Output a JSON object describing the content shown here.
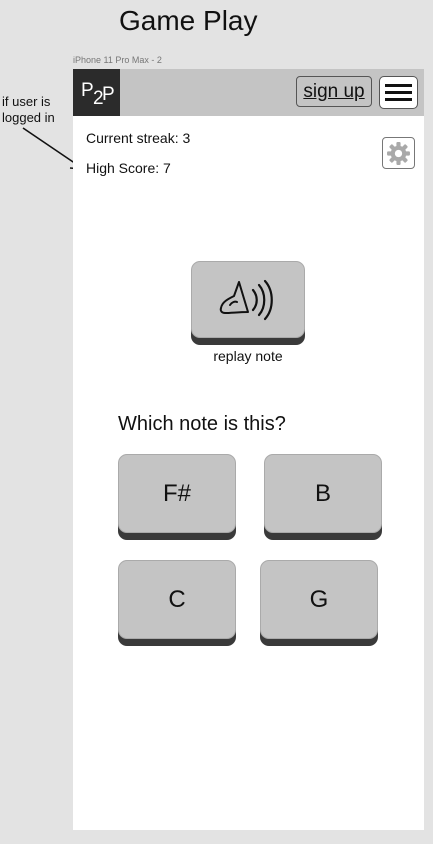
{
  "page": {
    "title": "Game Play",
    "frame_label": "iPhone 11 Pro Max - 2"
  },
  "annotation": {
    "line1": "if user is",
    "line2": "logged in"
  },
  "navbar": {
    "logo": {
      "p1": "P",
      "two": "2",
      "p2": "P"
    },
    "signup_label": "sign up",
    "menu_icon": "hamburger-menu-icon",
    "background": "#c4c4c4",
    "logo_background": "#2b2b2b"
  },
  "stats": {
    "current_streak": "Current streak: 3",
    "high_score": "High Score: 7"
  },
  "settings": {
    "icon": "gear-icon"
  },
  "replay": {
    "label": "replay note",
    "icon": "speaker-icon"
  },
  "question": "Which note is this?",
  "answers": [
    {
      "label": "F#"
    },
    {
      "label": "B"
    },
    {
      "label": "C"
    },
    {
      "label": "G"
    }
  ],
  "colors": {
    "button_face": "#c4c4c4",
    "button_shadow": "#3a3a3a",
    "canvas": "#e3e3e3",
    "screen": "#ffffff"
  }
}
